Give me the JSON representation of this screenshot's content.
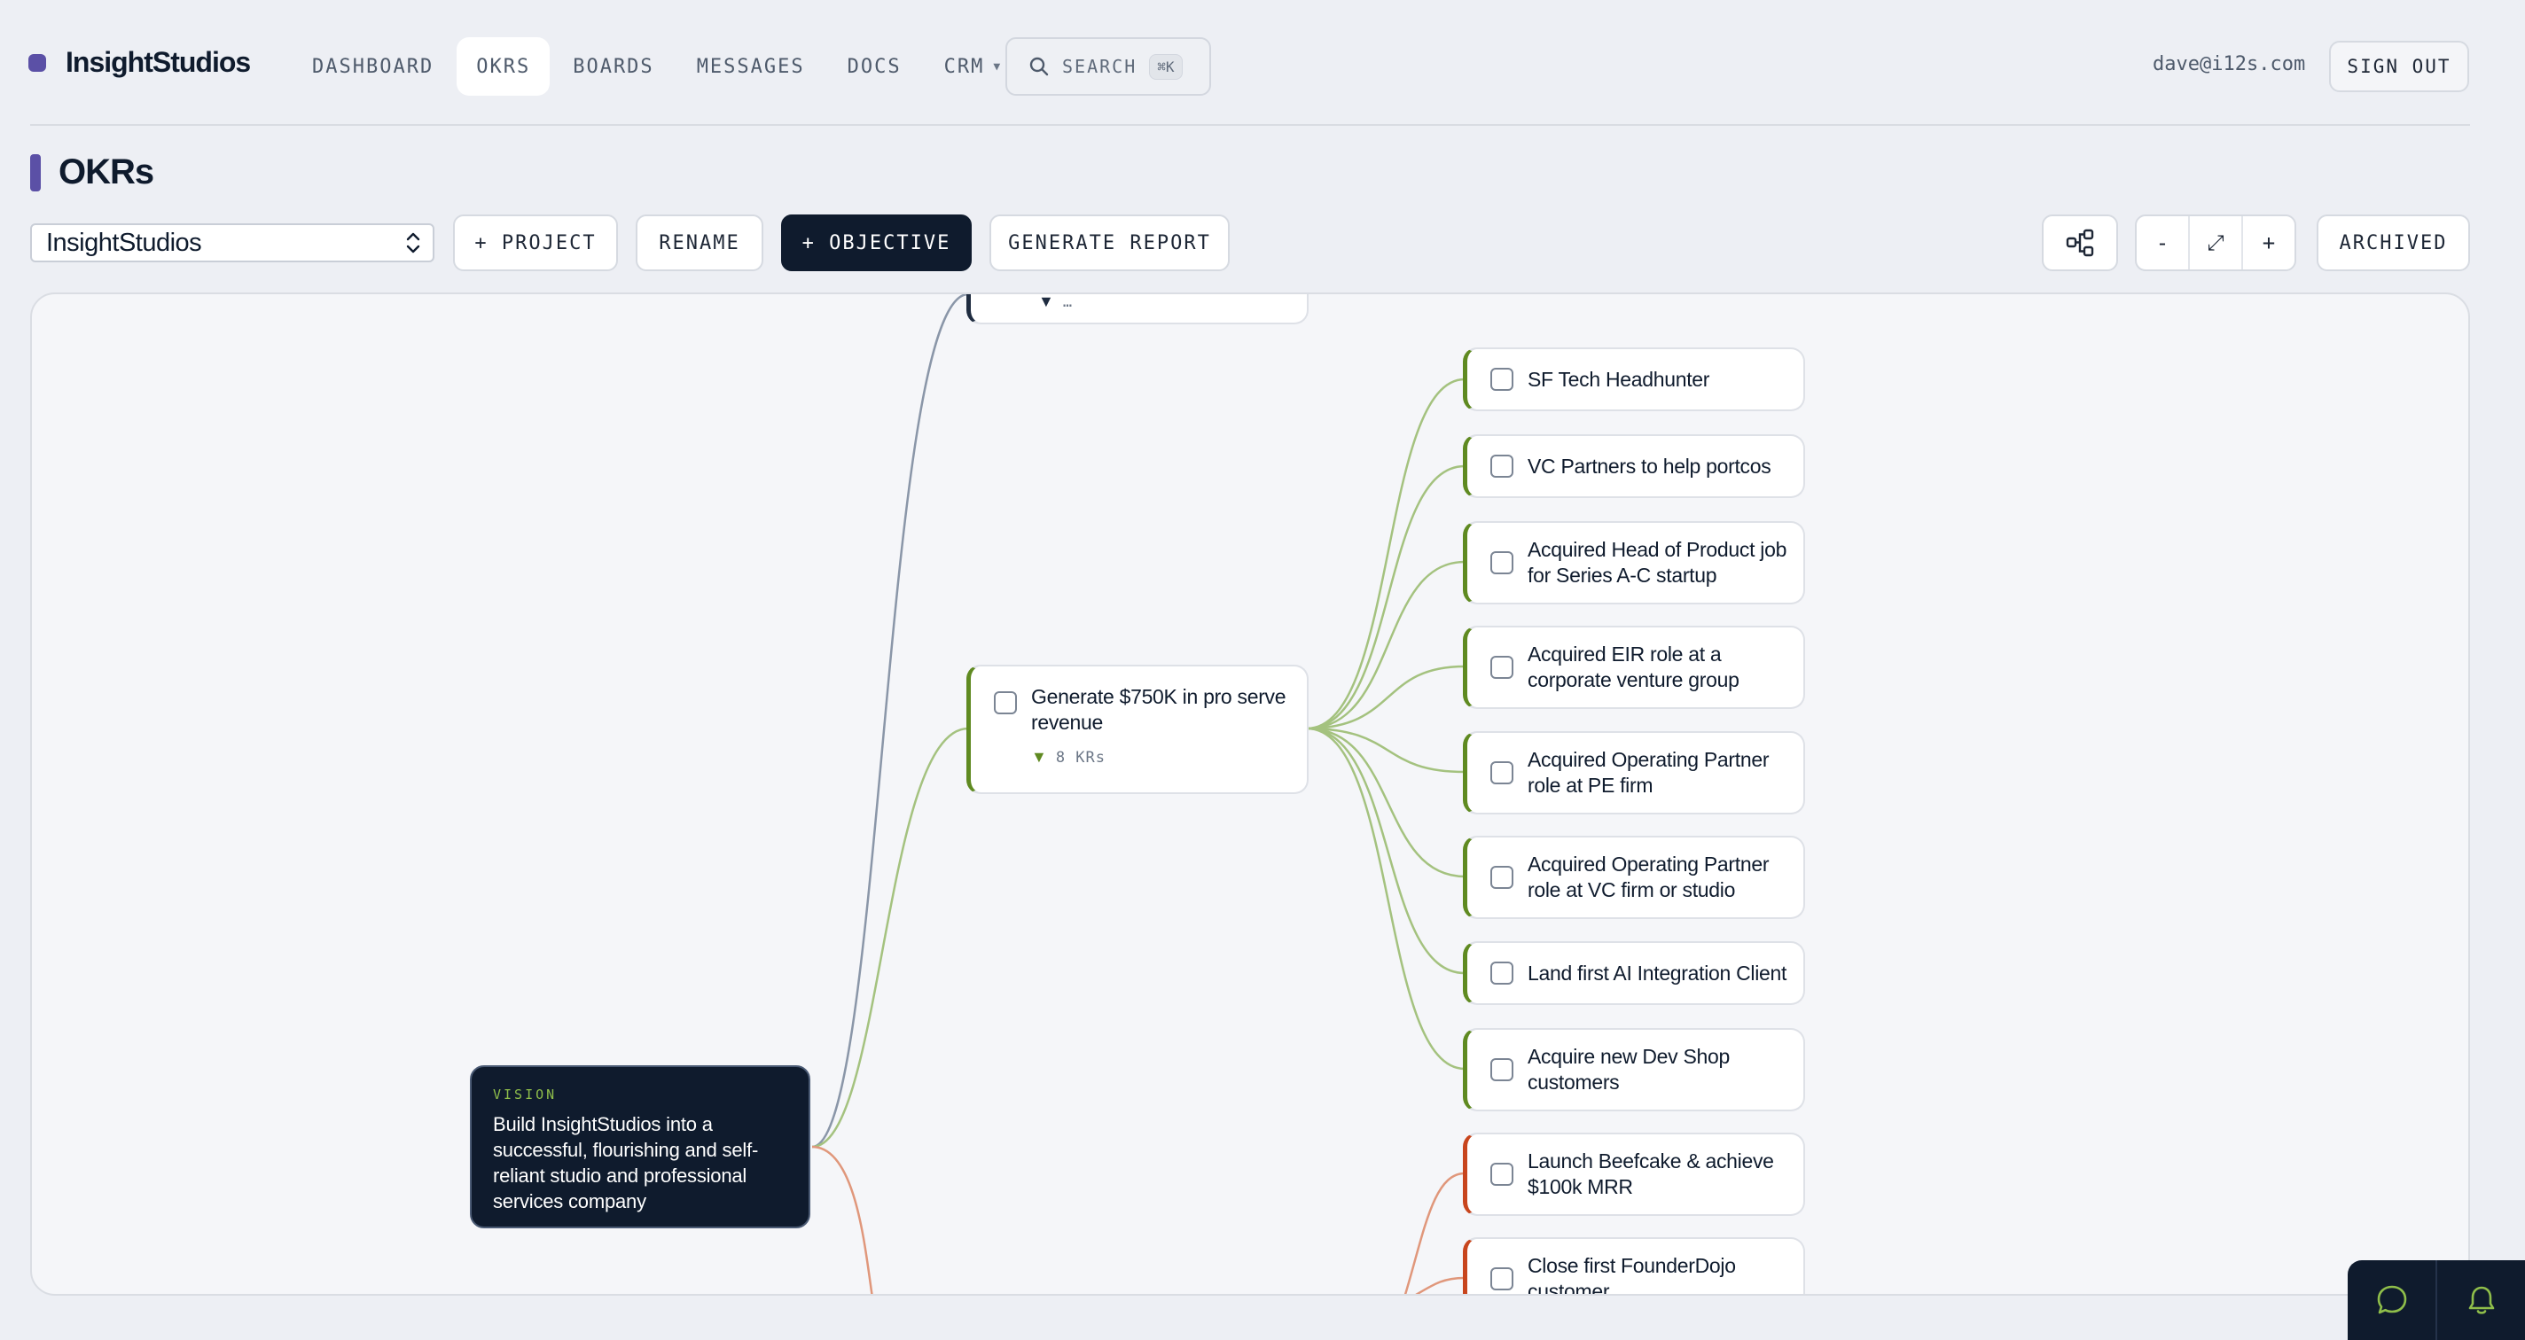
{
  "app": {
    "name": "InsightStudios",
    "brand_color": "#5b50a6"
  },
  "nav": {
    "items": [
      {
        "label": "DASHBOARD",
        "active": false
      },
      {
        "label": "OKRS",
        "active": true
      },
      {
        "label": "BOARDS",
        "active": false
      },
      {
        "label": "MESSAGES",
        "active": false
      },
      {
        "label": "DOCS",
        "active": false
      },
      {
        "label": "CRM",
        "active": false,
        "dropdown": true
      }
    ],
    "search": {
      "label": "SEARCH",
      "shortcut": "⌘K",
      "icon": "search-icon"
    },
    "user_email": "dave@i12s.com",
    "signout_label": "SIGN OUT"
  },
  "page": {
    "title": "OKRs"
  },
  "toolbar": {
    "project_select": "InsightStudios",
    "add_project_label": "+ PROJECT",
    "rename_label": "RENAME",
    "add_objective_label": "+ OBJECTIVE",
    "generate_report_label": "GENERATE REPORT",
    "layout_icon": "tree-layout-icon",
    "zoom_out_label": "-",
    "zoom_fit_label": "⤢",
    "zoom_in_label": "+",
    "archived_label": "ARCHIVED"
  },
  "colors": {
    "green": "#5f8a21",
    "red": "#c8451d",
    "navy": "#0f1b2d",
    "edge_green": "#a4c27f",
    "edge_red": "#e0977b",
    "edge_gray": "#8a96a8"
  },
  "vision": {
    "tag": "VISION",
    "text": "Build InsightStudios into a successful, flourishing and self-reliant studio and professional services company"
  },
  "objectives": {
    "top_partial": {
      "kr_label": "…"
    },
    "revenue": {
      "text": "Generate $750K in pro serve revenue",
      "kr_label": "8 KRs"
    }
  },
  "key_results": [
    {
      "text": "SF Tech Headhunter",
      "color": "green"
    },
    {
      "text": "VC Partners to help portcos",
      "color": "green"
    },
    {
      "text": "Acquired Head of Product job for Series A-C startup",
      "color": "green"
    },
    {
      "text": "Acquired EIR role at a corporate venture group",
      "color": "green"
    },
    {
      "text": "Acquired Operating Partner role at PE firm",
      "color": "green"
    },
    {
      "text": "Acquired Operating Partner role at VC firm or studio",
      "color": "green"
    },
    {
      "text": "Land first AI Integration Client",
      "color": "green"
    },
    {
      "text": "Acquire new Dev Shop customers",
      "color": "green"
    },
    {
      "text": "Launch Beefcake & achieve $100k MRR",
      "color": "red"
    },
    {
      "text": "Close first FounderDojo customer",
      "color": "red"
    }
  ],
  "dock": {
    "chat_icon": "chat-bubble-icon",
    "bell_icon": "bell-icon"
  }
}
